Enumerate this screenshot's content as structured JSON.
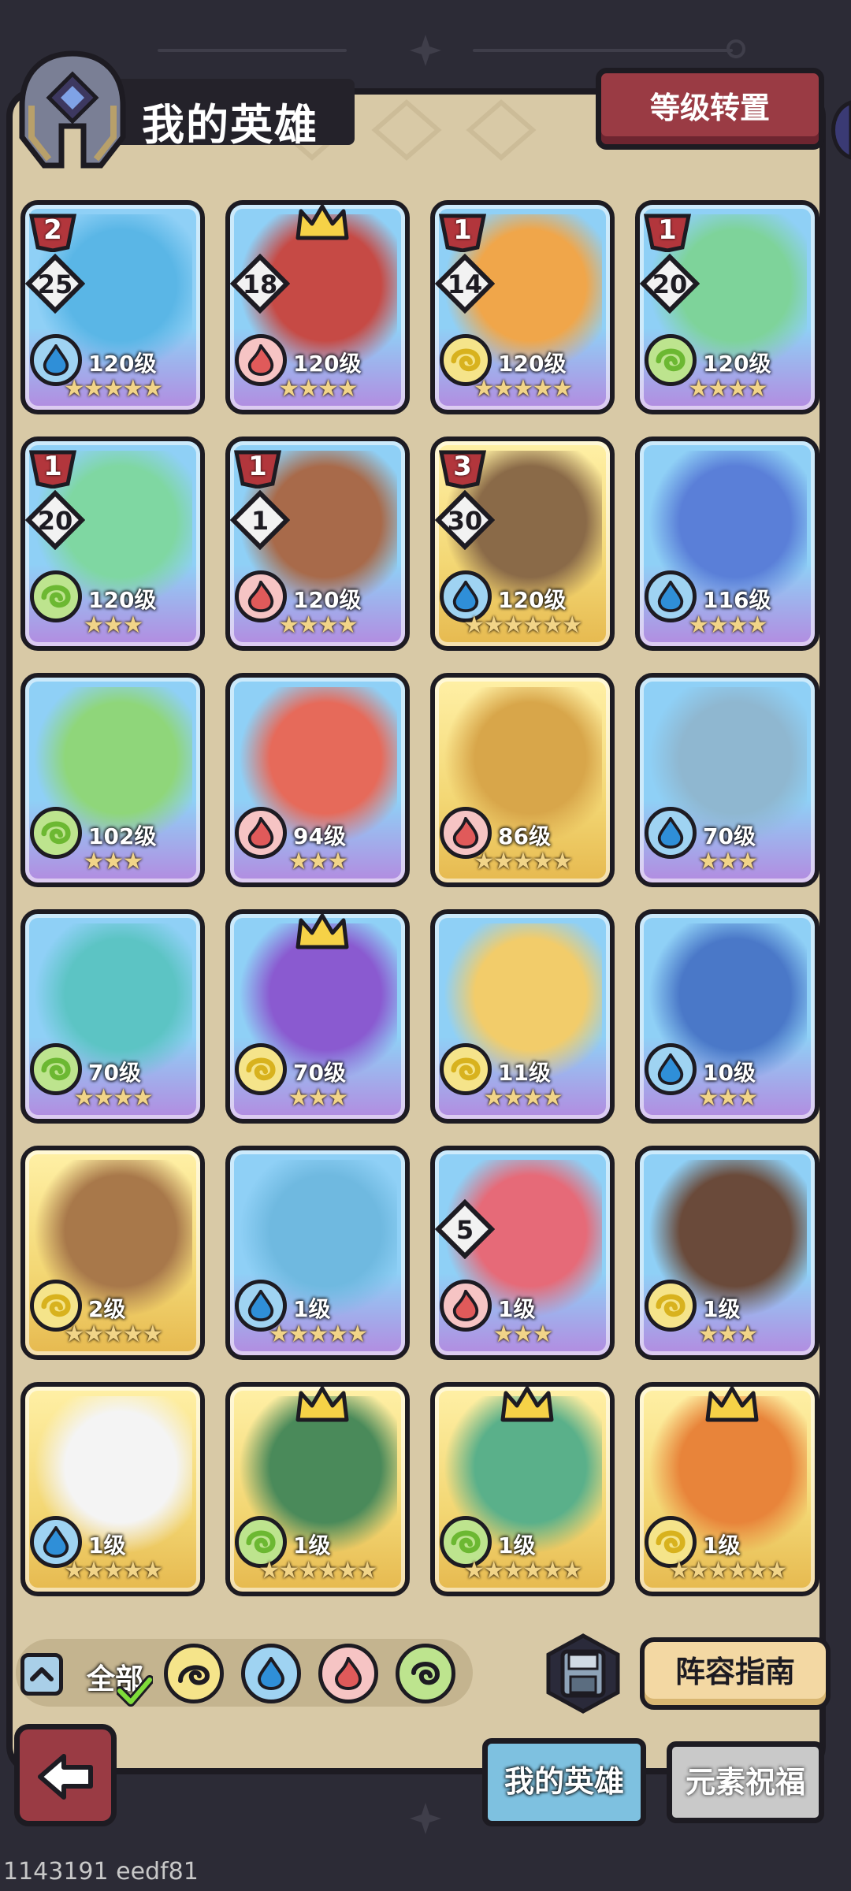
{
  "header": {
    "title": "我的英雄",
    "level_reset_label": "等级转置"
  },
  "heroes": [
    {
      "level": "120级",
      "stars": "★★★★★",
      "element": "water",
      "rank": "2",
      "badge": "25",
      "crown": false,
      "bg": "purple"
    },
    {
      "level": "120级",
      "stars": "★★★★",
      "element": "fire",
      "rank": "",
      "badge": "18",
      "crown": true,
      "bg": "purple"
    },
    {
      "level": "120级",
      "stars": "★★★★★",
      "element": "earth",
      "rank": "1",
      "badge": "14",
      "crown": false,
      "bg": "purple"
    },
    {
      "level": "120级",
      "stars": "★★★★",
      "element": "wind",
      "rank": "1",
      "badge": "20",
      "crown": false,
      "bg": "purple"
    },
    {
      "level": "120级",
      "stars": "★★★",
      "element": "wind",
      "rank": "1",
      "badge": "20",
      "crown": false,
      "bg": "purple"
    },
    {
      "level": "120级",
      "stars": "★★★★",
      "element": "fire",
      "rank": "1",
      "badge": "1",
      "crown": false,
      "bg": "purple"
    },
    {
      "level": "120级",
      "stars": "★★★★★★",
      "element": "water",
      "rank": "3",
      "badge": "30",
      "crown": false,
      "bg": "gold"
    },
    {
      "level": "116级",
      "stars": "★★★★",
      "element": "water",
      "rank": "",
      "badge": "",
      "crown": false,
      "bg": "purple"
    },
    {
      "level": "102级",
      "stars": "★★★",
      "element": "wind",
      "rank": "",
      "badge": "",
      "crown": false,
      "bg": "purple"
    },
    {
      "level": "94级",
      "stars": "★★★",
      "element": "fire",
      "rank": "",
      "badge": "",
      "crown": false,
      "bg": "purple"
    },
    {
      "level": "86级",
      "stars": "★★★★★",
      "element": "fire",
      "rank": "",
      "badge": "",
      "crown": false,
      "bg": "gold"
    },
    {
      "level": "70级",
      "stars": "★★★",
      "element": "water",
      "rank": "",
      "badge": "",
      "crown": false,
      "bg": "purple"
    },
    {
      "level": "70级",
      "stars": "★★★★",
      "element": "wind",
      "rank": "",
      "badge": "",
      "crown": false,
      "bg": "purple"
    },
    {
      "level": "70级",
      "stars": "★★★",
      "element": "earth",
      "rank": "",
      "badge": "",
      "crown": true,
      "bg": "purple"
    },
    {
      "level": "11级",
      "stars": "★★★★",
      "element": "earth",
      "rank": "",
      "badge": "",
      "crown": false,
      "bg": "purple"
    },
    {
      "level": "10级",
      "stars": "★★★",
      "element": "water",
      "rank": "",
      "badge": "",
      "crown": false,
      "bg": "purple"
    },
    {
      "level": "2级",
      "stars": "★★★★★",
      "element": "earth",
      "rank": "",
      "badge": "",
      "crown": false,
      "bg": "gold"
    },
    {
      "level": "1级",
      "stars": "★★★★★",
      "element": "water",
      "rank": "",
      "badge": "",
      "crown": false,
      "bg": "purple"
    },
    {
      "level": "1级",
      "stars": "★★★",
      "element": "fire",
      "rank": "",
      "badge": "5",
      "crown": false,
      "bg": "purple"
    },
    {
      "level": "1级",
      "stars": "★★★",
      "element": "earth",
      "rank": "",
      "badge": "",
      "crown": false,
      "bg": "purple"
    },
    {
      "level": "1级",
      "stars": "★★★★★",
      "element": "water",
      "rank": "",
      "badge": "",
      "crown": false,
      "bg": "gold"
    },
    {
      "level": "1级",
      "stars": "★★★★★★",
      "element": "wind",
      "rank": "",
      "badge": "",
      "crown": true,
      "bg": "gold"
    },
    {
      "level": "1级",
      "stars": "★★★★★★",
      "element": "wind",
      "rank": "",
      "badge": "",
      "crown": true,
      "bg": "gold"
    },
    {
      "level": "1级",
      "stars": "★★★★★★",
      "element": "earth",
      "rank": "",
      "badge": "",
      "crown": true,
      "bg": "gold"
    }
  ],
  "filters": {
    "all_label": "全部",
    "elements": [
      "earth",
      "water",
      "fire",
      "wind"
    ],
    "selected": "all"
  },
  "footer": {
    "guide_label": "阵容指南",
    "tab_my_heroes": "我的英雄",
    "tab_blessing": "元素祝福",
    "active_tab": "tab_my_heroes"
  },
  "colors": {
    "water": "#2f8fd8",
    "fire": "#e05a5a",
    "earth": "#d8b21e",
    "wind": "#6cb832",
    "panel": "#d8c9a6",
    "dark": "#1d1b22",
    "accent_red": "#9a3b44"
  },
  "debug_label": "1143191 eedf81"
}
